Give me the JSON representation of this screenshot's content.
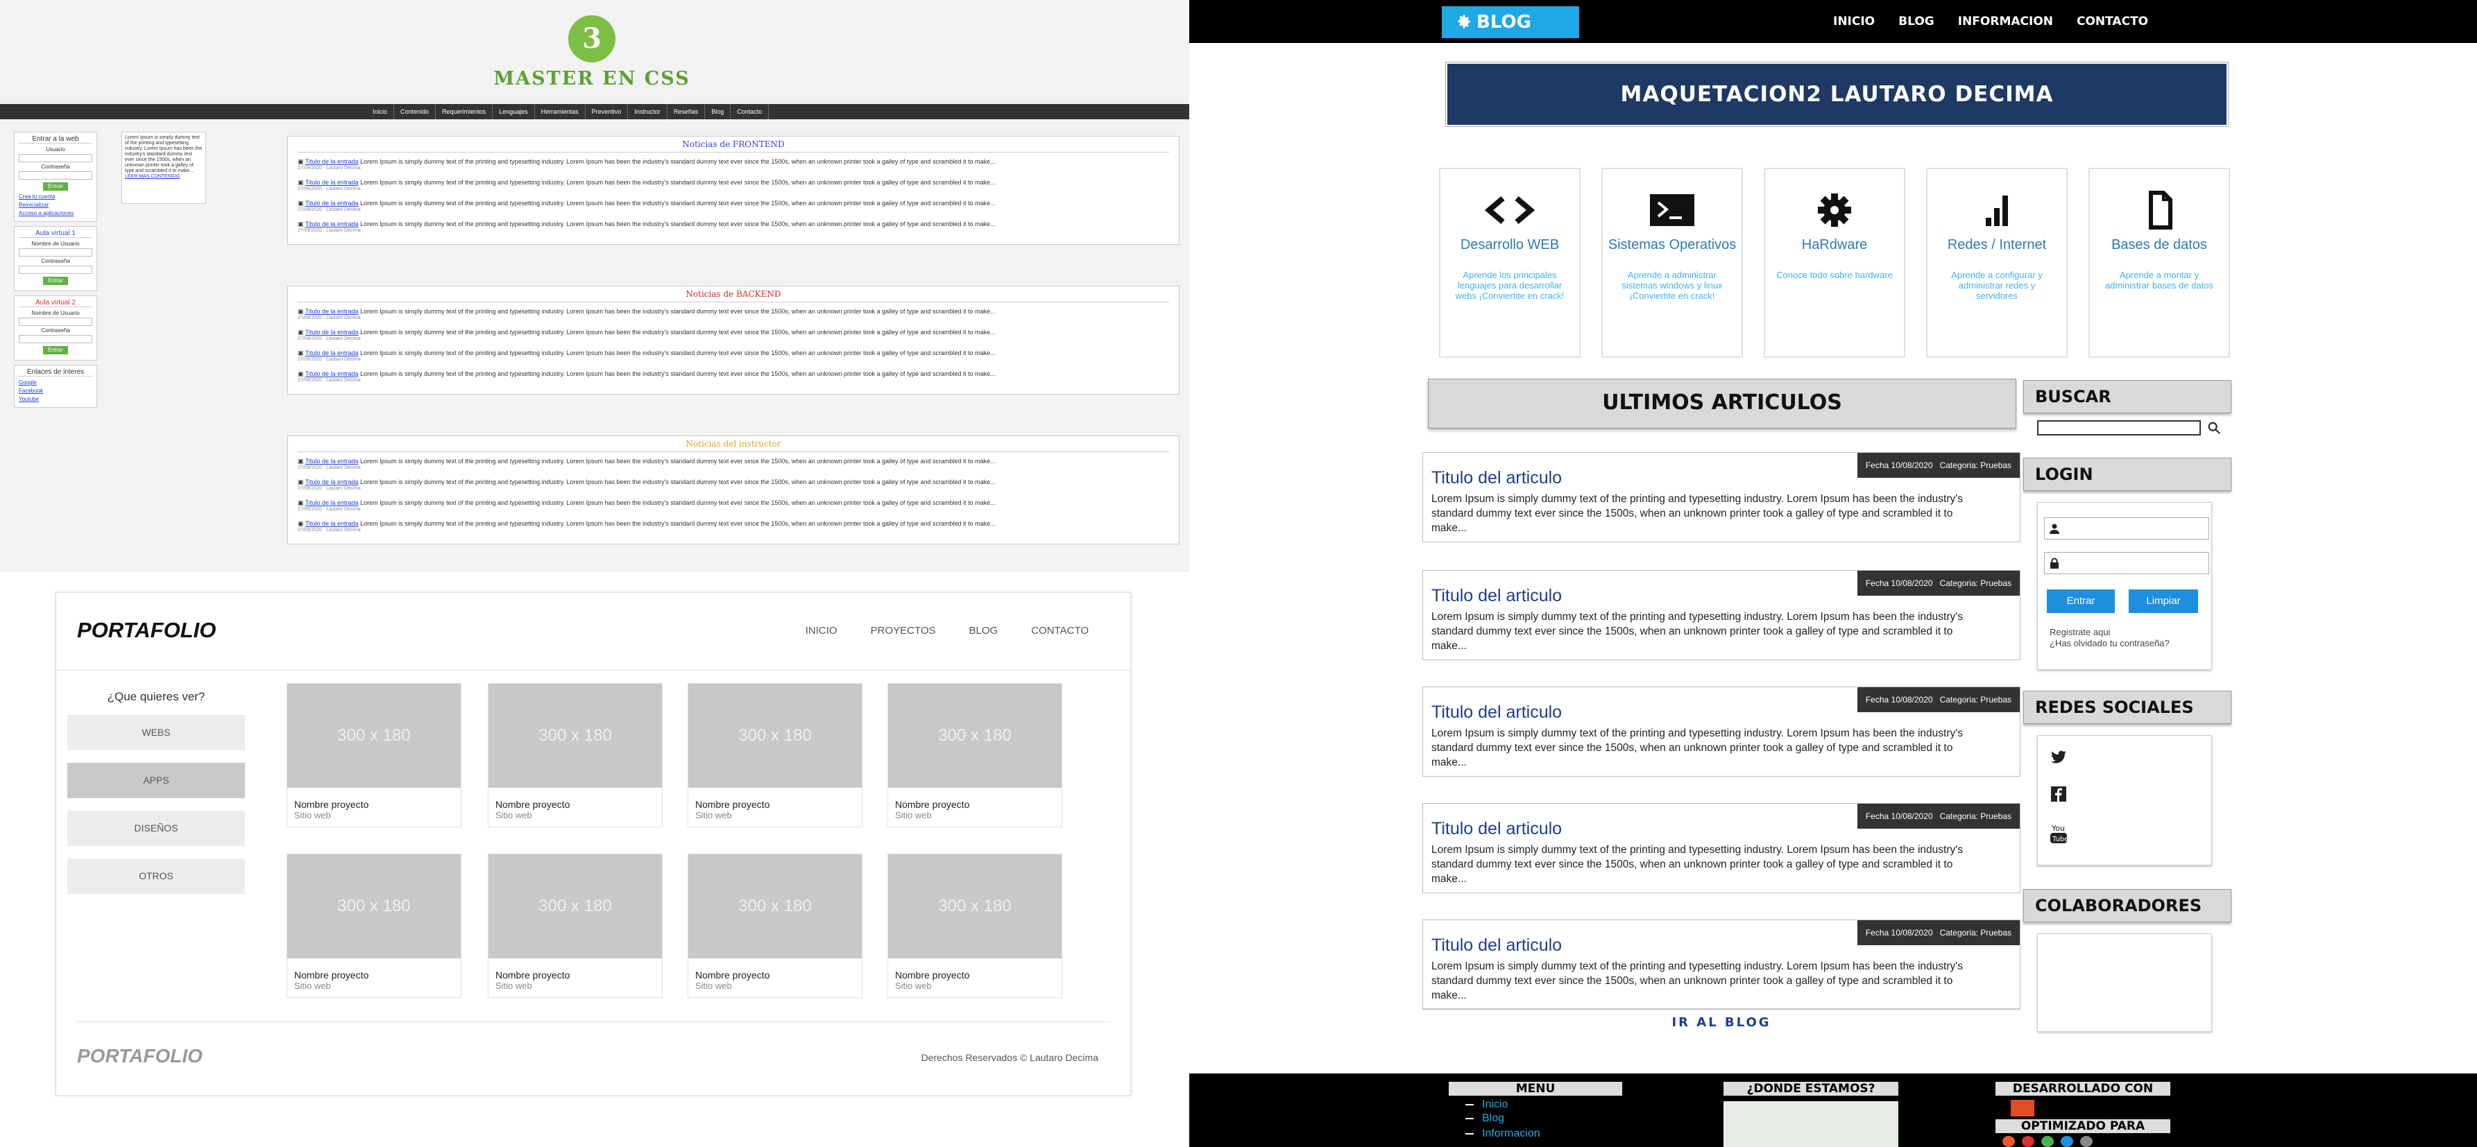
{
  "panel_a": {
    "logo_glyph": "3",
    "title": "MASTER EN CSS",
    "nav": [
      "Inicio",
      "Contenido",
      "Requerimientos",
      "Lenguajes",
      "Herramientas",
      "Preventivo",
      "Instructor",
      "Reseñas",
      "Blog",
      "Contacto"
    ],
    "login": {
      "title": "Entrar a la web",
      "user_label": "Usuario",
      "pass_label": "Contraseña",
      "button": "Entrar",
      "links": [
        "Crea tu cuenta",
        "Reinicializar",
        "Acceso a aplicaciones"
      ]
    },
    "aula1": {
      "title": "Aula virtual 1",
      "user_label": "Nombre de Usuario",
      "pass_label": "Contraseña",
      "button": "Entrar"
    },
    "aula2": {
      "title": "Aula virtual 2",
      "user_label": "Nombre de Usuario",
      "pass_label": "Contraseña",
      "button": "Entrar"
    },
    "enlaces": {
      "title": "Enlaces de interes",
      "items": [
        "Google",
        "Facebook",
        "Youtube"
      ]
    },
    "note": {
      "text": "Lorem Ipsum is simply dummy text of the printing and typesetting industry. Lorem Ipsum has been the industry's standard dummy text ever since the 1500s, when an unknown printer took a galley of type and scrambled it to make...",
      "link": "LEER MAS CONTENIDO"
    },
    "news_sections": [
      {
        "title": "Noticias de FRONTEND",
        "color": "#2a3fd6"
      },
      {
        "title": "Noticias de BACKEND",
        "color": "#d62a2a"
      },
      {
        "title": "Noticias del instructor",
        "color": "#e0a020"
      }
    ],
    "news_item": {
      "link": "Titulo de la entrada",
      "text": " Lorem Ipsum is simply dummy text of the printing and typesetting industry. Lorem Ipsum has been the industry's standard dummy text ever since the 1500s, when an unknown printer took a galley of type and scrambled it to make...",
      "meta": "27/09/2020 · Lautaro Decima"
    }
  },
  "panel_b": {
    "brand": "PORTAFOLIO",
    "nav": [
      "INICIO",
      "PROYECTOS",
      "BLOG",
      "CONTACTO"
    ],
    "filter_question": "¿Que quieres ver?",
    "filters": [
      "WEBS",
      "APPS",
      "DISEÑOS",
      "OTROS"
    ],
    "active_filter": "APPS",
    "placeholder_text": "300 x 180",
    "card_name": "Nombre proyecto",
    "card_sub": "Sitio web",
    "footer_brand": "PORTAFOLIO",
    "copyright": "Derechos Reservados © Lautaro Decima"
  },
  "panel_c": {
    "brand": "BLOG",
    "nav": [
      "INICIO",
      "BLOG",
      "INFORMACION",
      "CONTACTO"
    ],
    "banner": "MAQUETACION2 LAUTARO DECIMA",
    "features": [
      {
        "icon": "code-icon",
        "title": "Desarrollo WEB",
        "desc": "Aprende los principales lenguajes para desarrollar webs ¡Conviertite en crack!"
      },
      {
        "icon": "terminal-icon",
        "title": "Sistemas Operativos",
        "desc": "Aprende a administrar sistemas windows y linux ¡Conviertite en crack!"
      },
      {
        "icon": "gear-icon",
        "title": "HaRdware",
        "desc": "Conoce todo sobre hardware"
      },
      {
        "icon": "signal-icon",
        "title": "Redes / Internet",
        "desc": "Aprende a configurar y administrar redes y servidores"
      },
      {
        "icon": "document-icon",
        "title": "Bases de datos",
        "desc": "Aprende a montar y administrar bases de datos"
      }
    ],
    "section_title": "ULTIMOS ARTICULOS",
    "article": {
      "title": "Titulo del articulo",
      "date": "Fecha 10/08/2020",
      "category": "Categoria: Pruebas",
      "text": "Lorem Ipsum is simply dummy text of the printing and typesetting industry. Lorem Ipsum has been the industry's standard dummy text ever since the 1500s, when an unknown printer took a galley of type and scrambled it to make..."
    },
    "more_link": "IR AL BLOG",
    "widgets": {
      "search": "BUSCAR",
      "login": "LOGIN",
      "social": "REDES SOCIALES",
      "collab": "COLABORADORES"
    },
    "login": {
      "enter": "Entrar",
      "clear": "Limpiar",
      "register": "Registrate aqui",
      "forgot": "¿Has olvidado tu contraseña?"
    },
    "footer": {
      "menu": "MENU",
      "where": "¿DONDE ESTAMOS?",
      "dev": "DESARROLLADO CON",
      "opt": "OPTIMIZADO PARA",
      "menu_items": [
        "Inicio",
        "Blog",
        "Informacion"
      ]
    },
    "colors": {
      "accent": "#1ea8e6",
      "link": "#2a7ab8"
    }
  }
}
